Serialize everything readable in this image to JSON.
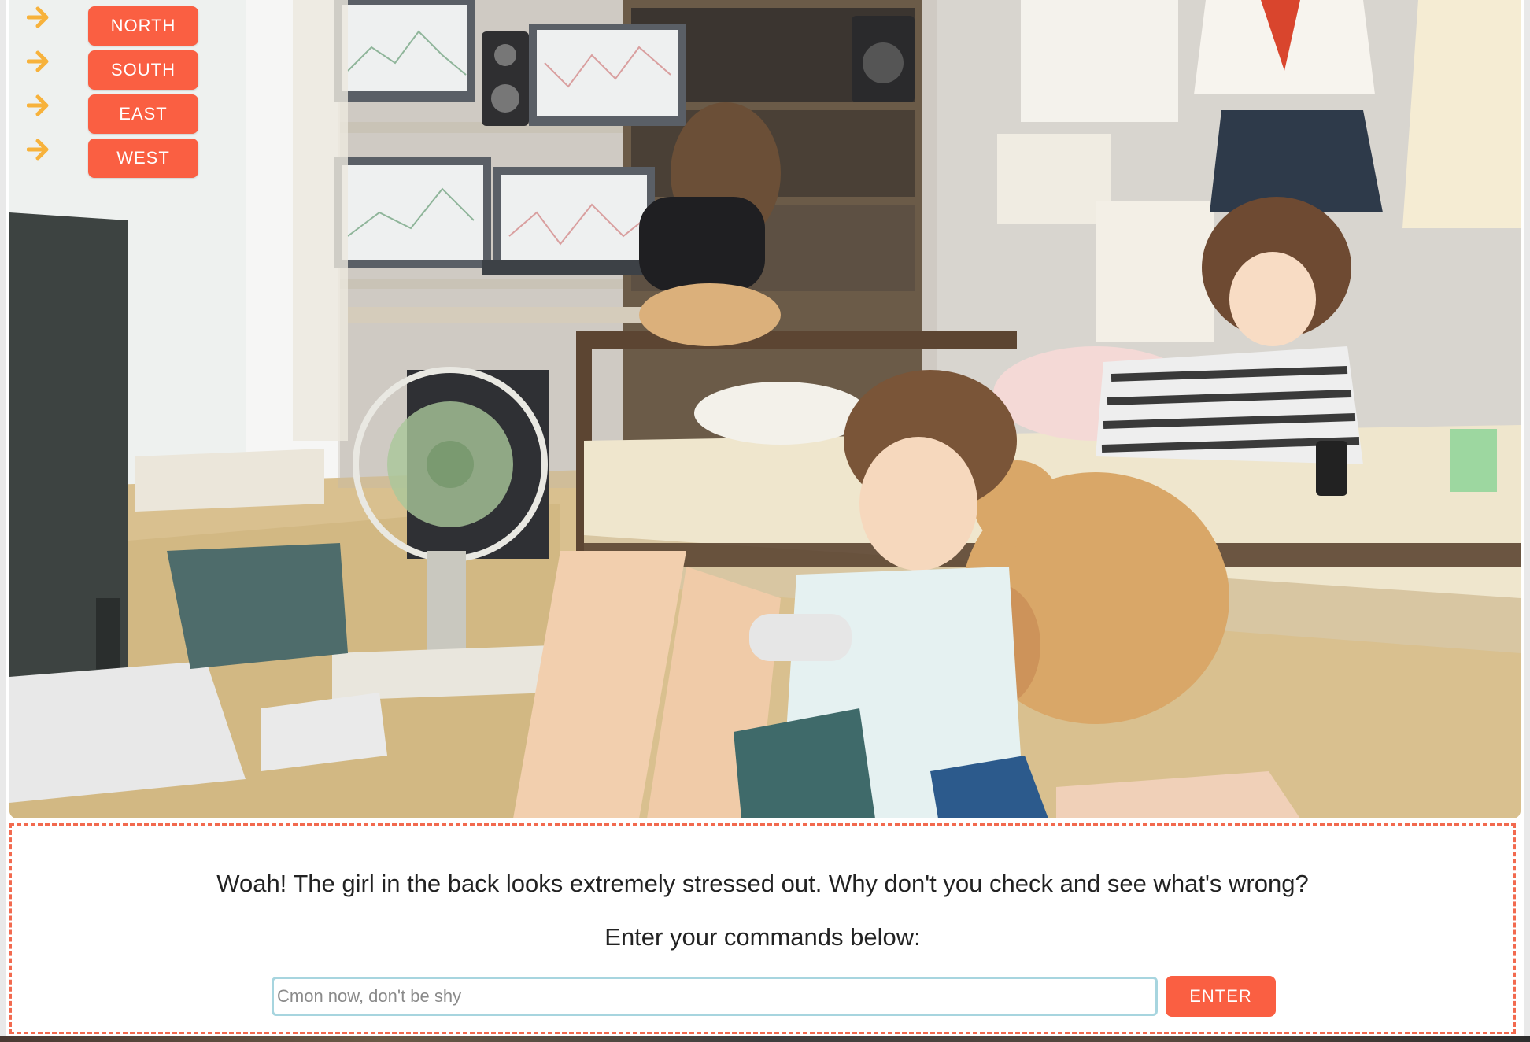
{
  "navigation": {
    "directions": [
      {
        "label": "NORTH"
      },
      {
        "label": "SOUTH"
      },
      {
        "label": "EAST"
      },
      {
        "label": "WEST"
      }
    ],
    "arrow_icon": "right-arrow-icon",
    "arrow_color": "#f7b23b",
    "button_color": "#fa5f42"
  },
  "scene": {
    "description_icon": "bedroom-scene-illustration"
  },
  "dialog": {
    "story_text": "Woah! The girl in the back looks extremely stressed out. Why don't you check and see what's wrong?",
    "prompt_label": "Enter your commands below:",
    "input_value": "",
    "input_placeholder": "Cmon now, don't be shy",
    "enter_label": "ENTER",
    "border_color": "#f26a4f"
  }
}
